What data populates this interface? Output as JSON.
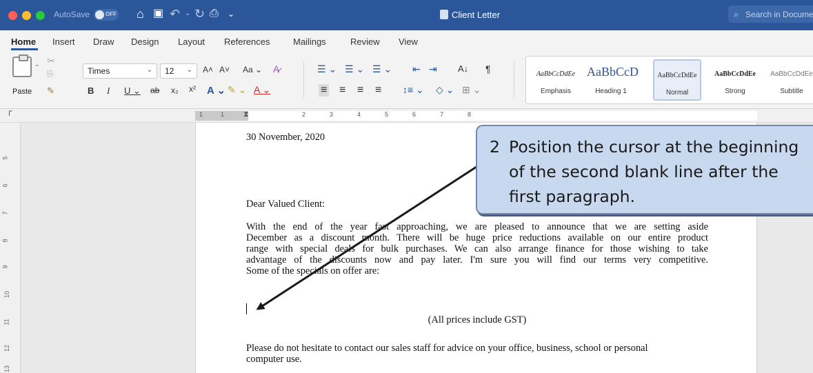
{
  "titlebar": {
    "autosave_label": "AutoSave",
    "autosave_state": "OFF",
    "document_title": "Client Letter",
    "search_placeholder": "Search in Document"
  },
  "tabs": [
    "Home",
    "Insert",
    "Draw",
    "Design",
    "Layout",
    "References",
    "Mailings",
    "Review",
    "View"
  ],
  "ribbon": {
    "paste_label": "Paste",
    "font_name": "Times",
    "font_size": "12",
    "styles": [
      {
        "preview": "AaBbCcDdEe",
        "name": "Emphasis"
      },
      {
        "preview": "AaBbCcD",
        "name": "Heading 1"
      },
      {
        "preview": "AaBbCcDdEe",
        "name": "Normal"
      },
      {
        "preview": "AaBbCcDdEe",
        "name": "Strong"
      },
      {
        "preview": "AaBbCcDdEe",
        "name": "Subtitle"
      }
    ]
  },
  "ruler": {
    "top_numbers": [
      "1",
      "1",
      "2",
      "3",
      "4",
      "5",
      "6",
      "7",
      "8"
    ],
    "left_numbers": [
      "5",
      "6",
      "7",
      "8",
      "9",
      "10",
      "11",
      "12",
      "13"
    ]
  },
  "document": {
    "date": "30 November, 2020",
    "salutation": "Dear Valued Client:",
    "paragraph1_lines": [
      "With the end of the year fast approaching, we are pleased to announce that we are setting aside",
      "December as a discount month. There will be huge price reductions available on our entire product",
      "range with special deals for bulk purchases. We can also arrange finance for those wishing to take",
      "advantage of the discounts now and pay later. I'm sure you will find our terms very competitive.",
      "Some of the specials on offer are:"
    ],
    "gst_note": "(All prices include GST)",
    "paragraph2_lines": [
      "Please do not hesitate to contact our sales staff for advice on your office, business, school or personal",
      "computer use."
    ]
  },
  "callout": {
    "step_number": "2",
    "lines": [
      "Position the cursor at the beginning",
      "of the second blank line after the",
      "first paragraph."
    ]
  },
  "colors": {
    "titlebar": "#2b579a",
    "callout_fill": "#c8d9ef",
    "callout_border": "#6e88b2"
  }
}
